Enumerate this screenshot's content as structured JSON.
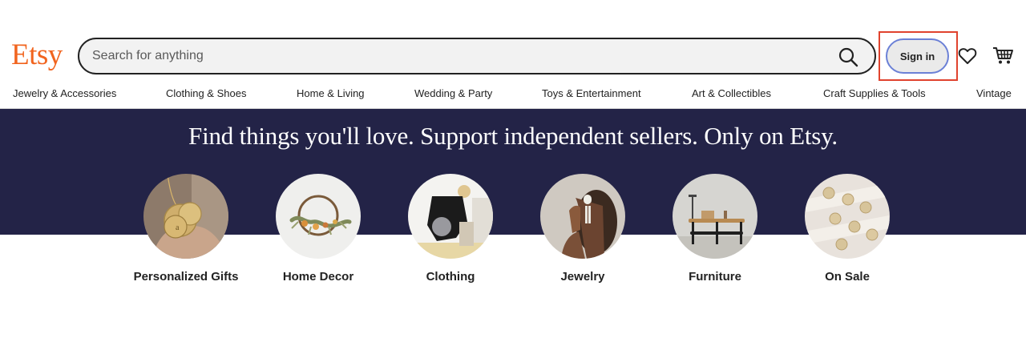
{
  "brand": {
    "logo": "Etsy",
    "color": "#f1641e"
  },
  "search": {
    "placeholder": "Search for anything",
    "value": "",
    "icon": "search-icon"
  },
  "account": {
    "signin_label": "Sign in",
    "favorites_icon": "heart-icon",
    "cart_icon": "cart-icon"
  },
  "categories": [
    "Jewelry & Accessories",
    "Clothing & Shoes",
    "Home & Living",
    "Wedding & Party",
    "Toys & Entertainment",
    "Art & Collectibles",
    "Craft Supplies & Tools",
    "Vintage"
  ],
  "hero": {
    "title": "Find things you'll love. Support independent sellers. Only on Etsy.",
    "background": "#232347"
  },
  "featured": [
    {
      "label": "Personalized Gifts",
      "image": "gold-pendant-necklace"
    },
    {
      "label": "Home Decor",
      "image": "dried-flower-wreath"
    },
    {
      "label": "Clothing",
      "image": "person-in-black-dress"
    },
    {
      "label": "Jewelry",
      "image": "woman-wearing-earring"
    },
    {
      "label": "Furniture",
      "image": "wooden-side-table"
    },
    {
      "label": "On Sale",
      "image": "coin-charm-necklaces"
    }
  ]
}
